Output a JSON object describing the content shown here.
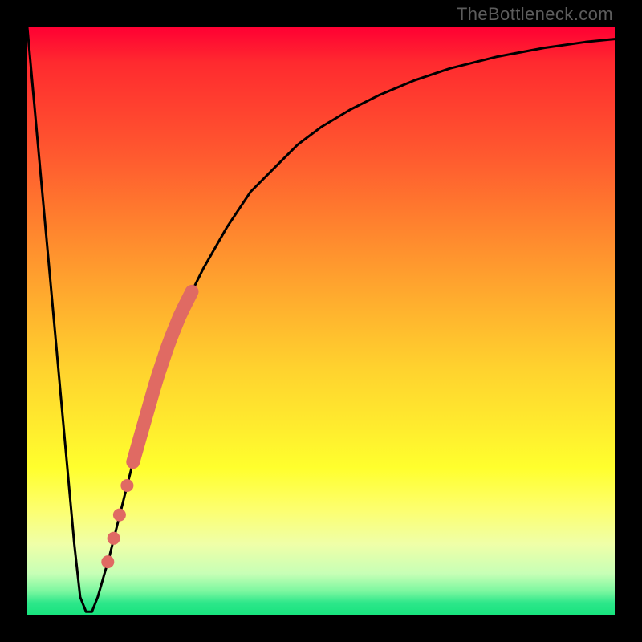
{
  "watermark": "TheBottleneck.com",
  "chart_data": {
    "type": "line",
    "title": "",
    "xlabel": "",
    "ylabel": "",
    "xlim": [
      0,
      100
    ],
    "ylim": [
      0,
      100
    ],
    "series": [
      {
        "name": "bottleneck-curve",
        "x": [
          0,
          2,
          4,
          6,
          8,
          9,
          10,
          11,
          12,
          14,
          16,
          18,
          20,
          22,
          24,
          26,
          28,
          30,
          34,
          38,
          42,
          46,
          50,
          55,
          60,
          66,
          72,
          80,
          88,
          95,
          100
        ],
        "y": [
          100,
          78,
          56,
          34,
          12,
          3,
          0.5,
          0.5,
          3,
          10,
          18,
          26,
          33,
          40,
          46,
          51,
          55,
          59,
          66,
          72,
          76,
          80,
          83,
          86,
          88.5,
          91,
          93,
          95,
          96.5,
          97.5,
          98
        ]
      }
    ],
    "highlight_segment": {
      "description": "thick coral stroke on rising branch mid-section",
      "x_range": [
        18,
        28
      ],
      "y_range": [
        18,
        55
      ]
    },
    "highlight_dots": {
      "description": "discrete coral markers just below thick segment",
      "points": [
        {
          "x": 17.0,
          "y": 22
        },
        {
          "x": 15.7,
          "y": 17
        },
        {
          "x": 14.7,
          "y": 13
        },
        {
          "x": 13.7,
          "y": 9
        }
      ]
    },
    "colors": {
      "curve": "#000000",
      "highlight": "#e06a63",
      "gradient_top": "#ff0033",
      "gradient_bottom": "#18e37e"
    }
  }
}
